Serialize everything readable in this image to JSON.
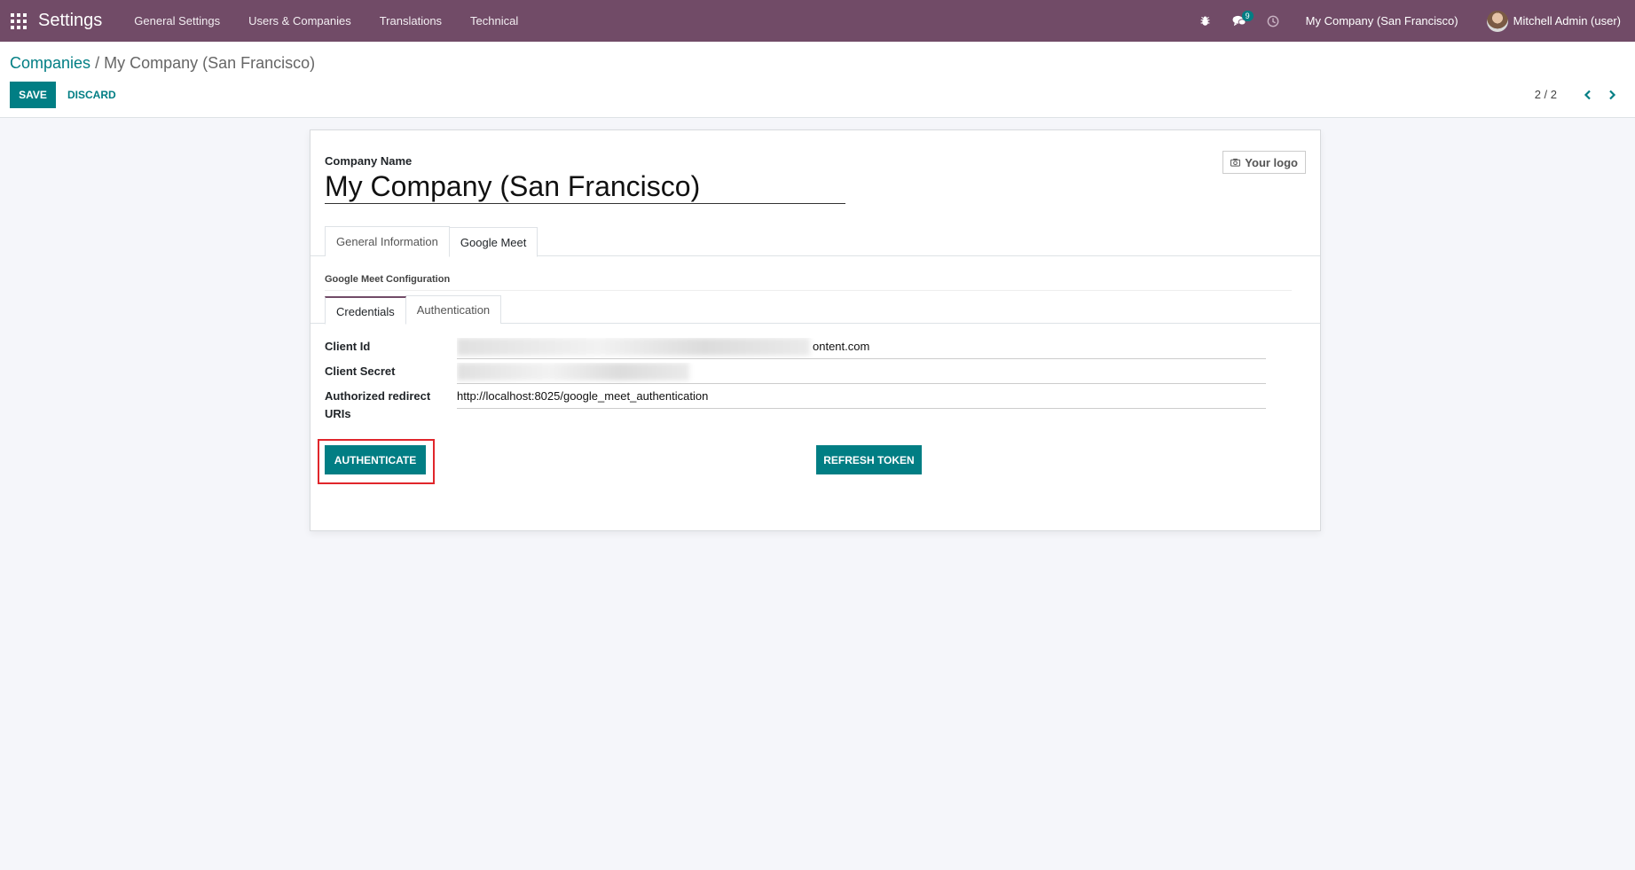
{
  "navbar": {
    "app_name": "Settings",
    "menu": [
      "General Settings",
      "Users & Companies",
      "Translations",
      "Technical"
    ],
    "messages_badge": "9",
    "company": "My Company (San Francisco)",
    "user": "Mitchell Admin (user)"
  },
  "control_panel": {
    "breadcrumb_parent": "Companies",
    "breadcrumb_separator": "/",
    "breadcrumb_current": "My Company (San Francisco)",
    "save_label": "SAVE",
    "discard_label": "DISCARD",
    "pager": "2 / 2"
  },
  "form": {
    "company_name_label": "Company Name",
    "company_name": "My Company (San Francisco)",
    "logo_label": "Your logo",
    "tabs": [
      "General Information",
      "Google Meet"
    ],
    "active_tab": "Google Meet",
    "section_title": "Google Meet Configuration",
    "sub_tabs": [
      "Credentials",
      "Authentication"
    ],
    "active_sub_tab": "Credentials",
    "client_id_label": "Client Id",
    "client_id_visible_suffix": "ontent.com",
    "client_secret_label": "Client Secret",
    "redirect_label": "Authorized redirect URIs",
    "redirect_value": "http://localhost:8025/google_meet_authentication",
    "authenticate_label": "AUTHENTICATE",
    "refresh_token_label": "REFRESH TOKEN"
  },
  "colors": {
    "navbar": "#714b67",
    "primary": "#017e84",
    "highlight": "#e0262b"
  }
}
